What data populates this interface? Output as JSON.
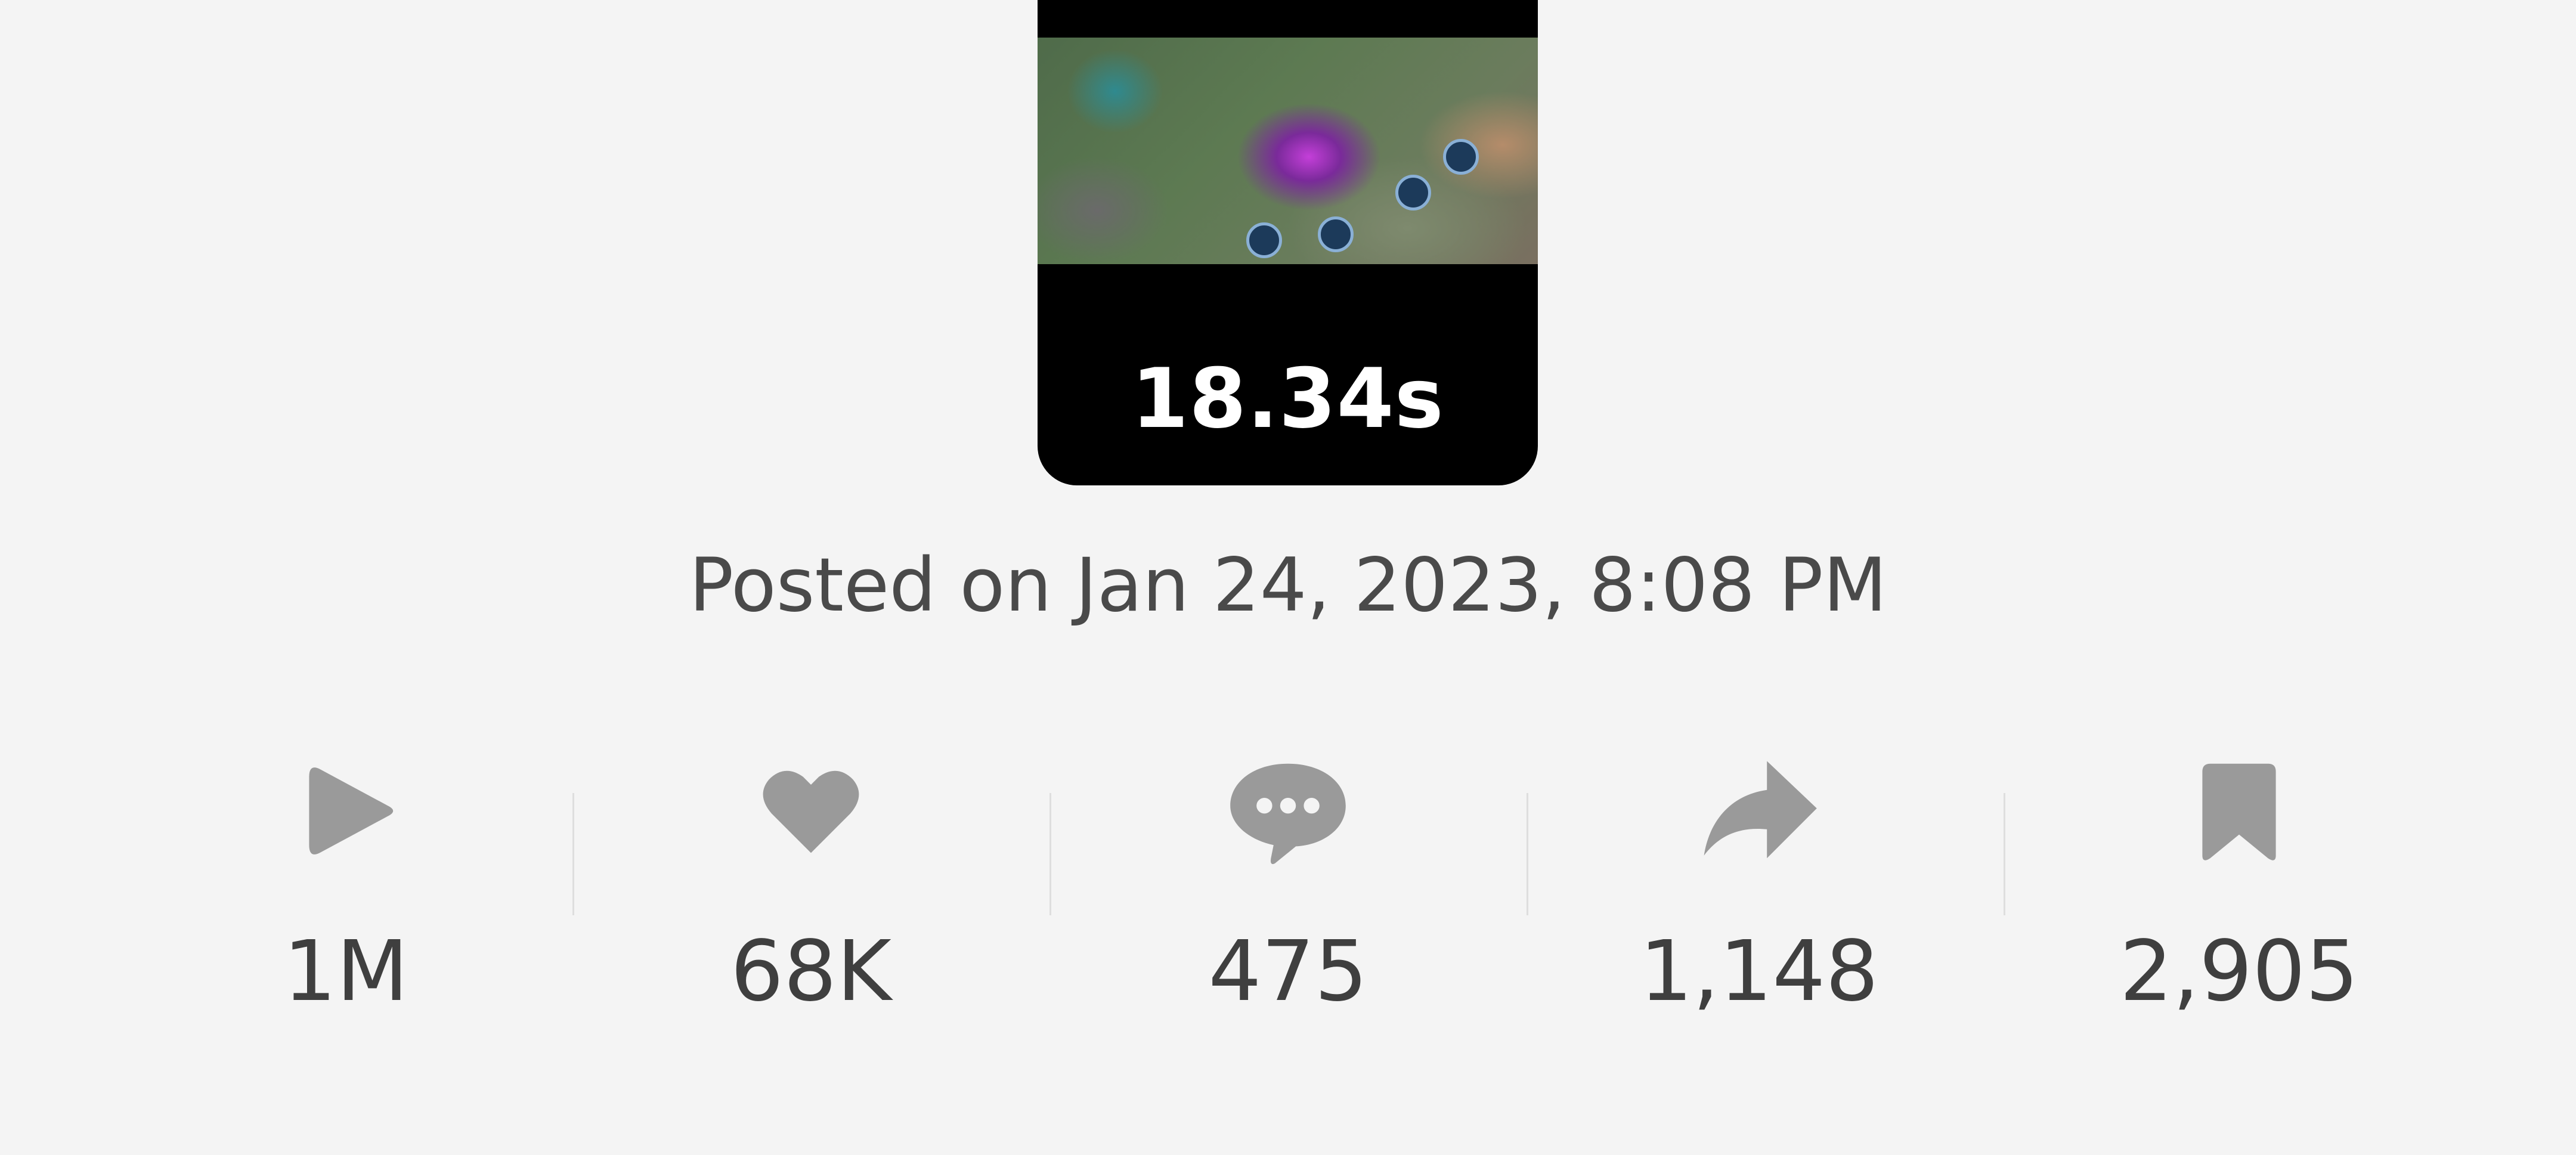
{
  "video": {
    "duration": "18.34s"
  },
  "posted_text": "Posted on Jan 24, 2023, 8:08 PM",
  "stats": [
    {
      "icon": "play-icon",
      "value": "1M"
    },
    {
      "icon": "heart-icon",
      "value": "68K"
    },
    {
      "icon": "comment-icon",
      "value": "475"
    },
    {
      "icon": "share-icon",
      "value": "1,148"
    },
    {
      "icon": "bookmark-icon",
      "value": "2,905"
    }
  ],
  "colors": {
    "background": "#f4f4f4",
    "icon": "#9a9a9a",
    "text": "#3f3f3f"
  }
}
